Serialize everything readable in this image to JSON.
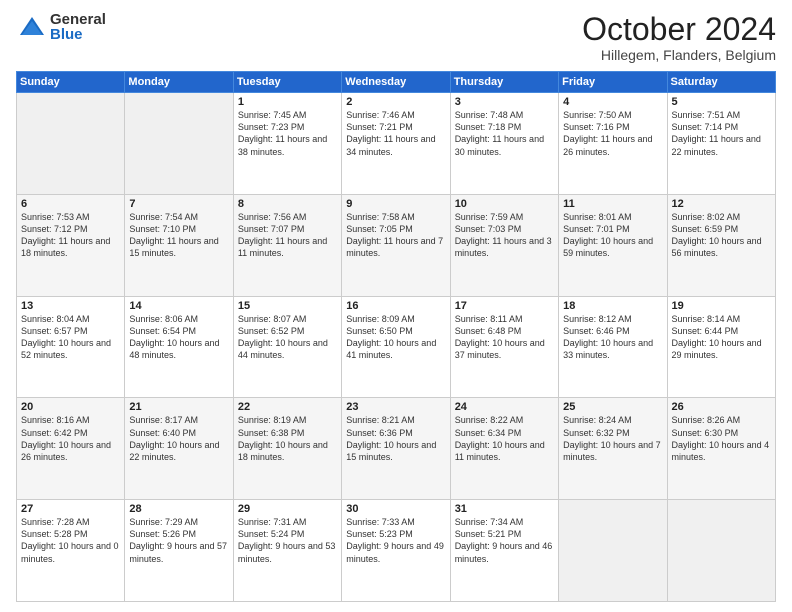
{
  "logo": {
    "general": "General",
    "blue": "Blue"
  },
  "title": "October 2024",
  "location": "Hillegem, Flanders, Belgium",
  "weekdays": [
    "Sunday",
    "Monday",
    "Tuesday",
    "Wednesday",
    "Thursday",
    "Friday",
    "Saturday"
  ],
  "weeks": [
    [
      {
        "day": "",
        "content": ""
      },
      {
        "day": "",
        "content": ""
      },
      {
        "day": "1",
        "content": "Sunrise: 7:45 AM\nSunset: 7:23 PM\nDaylight: 11 hours and 38 minutes."
      },
      {
        "day": "2",
        "content": "Sunrise: 7:46 AM\nSunset: 7:21 PM\nDaylight: 11 hours and 34 minutes."
      },
      {
        "day": "3",
        "content": "Sunrise: 7:48 AM\nSunset: 7:18 PM\nDaylight: 11 hours and 30 minutes."
      },
      {
        "day": "4",
        "content": "Sunrise: 7:50 AM\nSunset: 7:16 PM\nDaylight: 11 hours and 26 minutes."
      },
      {
        "day": "5",
        "content": "Sunrise: 7:51 AM\nSunset: 7:14 PM\nDaylight: 11 hours and 22 minutes."
      }
    ],
    [
      {
        "day": "6",
        "content": "Sunrise: 7:53 AM\nSunset: 7:12 PM\nDaylight: 11 hours and 18 minutes."
      },
      {
        "day": "7",
        "content": "Sunrise: 7:54 AM\nSunset: 7:10 PM\nDaylight: 11 hours and 15 minutes."
      },
      {
        "day": "8",
        "content": "Sunrise: 7:56 AM\nSunset: 7:07 PM\nDaylight: 11 hours and 11 minutes."
      },
      {
        "day": "9",
        "content": "Sunrise: 7:58 AM\nSunset: 7:05 PM\nDaylight: 11 hours and 7 minutes."
      },
      {
        "day": "10",
        "content": "Sunrise: 7:59 AM\nSunset: 7:03 PM\nDaylight: 11 hours and 3 minutes."
      },
      {
        "day": "11",
        "content": "Sunrise: 8:01 AM\nSunset: 7:01 PM\nDaylight: 10 hours and 59 minutes."
      },
      {
        "day": "12",
        "content": "Sunrise: 8:02 AM\nSunset: 6:59 PM\nDaylight: 10 hours and 56 minutes."
      }
    ],
    [
      {
        "day": "13",
        "content": "Sunrise: 8:04 AM\nSunset: 6:57 PM\nDaylight: 10 hours and 52 minutes."
      },
      {
        "day": "14",
        "content": "Sunrise: 8:06 AM\nSunset: 6:54 PM\nDaylight: 10 hours and 48 minutes."
      },
      {
        "day": "15",
        "content": "Sunrise: 8:07 AM\nSunset: 6:52 PM\nDaylight: 10 hours and 44 minutes."
      },
      {
        "day": "16",
        "content": "Sunrise: 8:09 AM\nSunset: 6:50 PM\nDaylight: 10 hours and 41 minutes."
      },
      {
        "day": "17",
        "content": "Sunrise: 8:11 AM\nSunset: 6:48 PM\nDaylight: 10 hours and 37 minutes."
      },
      {
        "day": "18",
        "content": "Sunrise: 8:12 AM\nSunset: 6:46 PM\nDaylight: 10 hours and 33 minutes."
      },
      {
        "day": "19",
        "content": "Sunrise: 8:14 AM\nSunset: 6:44 PM\nDaylight: 10 hours and 29 minutes."
      }
    ],
    [
      {
        "day": "20",
        "content": "Sunrise: 8:16 AM\nSunset: 6:42 PM\nDaylight: 10 hours and 26 minutes."
      },
      {
        "day": "21",
        "content": "Sunrise: 8:17 AM\nSunset: 6:40 PM\nDaylight: 10 hours and 22 minutes."
      },
      {
        "day": "22",
        "content": "Sunrise: 8:19 AM\nSunset: 6:38 PM\nDaylight: 10 hours and 18 minutes."
      },
      {
        "day": "23",
        "content": "Sunrise: 8:21 AM\nSunset: 6:36 PM\nDaylight: 10 hours and 15 minutes."
      },
      {
        "day": "24",
        "content": "Sunrise: 8:22 AM\nSunset: 6:34 PM\nDaylight: 10 hours and 11 minutes."
      },
      {
        "day": "25",
        "content": "Sunrise: 8:24 AM\nSunset: 6:32 PM\nDaylight: 10 hours and 7 minutes."
      },
      {
        "day": "26",
        "content": "Sunrise: 8:26 AM\nSunset: 6:30 PM\nDaylight: 10 hours and 4 minutes."
      }
    ],
    [
      {
        "day": "27",
        "content": "Sunrise: 7:28 AM\nSunset: 5:28 PM\nDaylight: 10 hours and 0 minutes."
      },
      {
        "day": "28",
        "content": "Sunrise: 7:29 AM\nSunset: 5:26 PM\nDaylight: 9 hours and 57 minutes."
      },
      {
        "day": "29",
        "content": "Sunrise: 7:31 AM\nSunset: 5:24 PM\nDaylight: 9 hours and 53 minutes."
      },
      {
        "day": "30",
        "content": "Sunrise: 7:33 AM\nSunset: 5:23 PM\nDaylight: 9 hours and 49 minutes."
      },
      {
        "day": "31",
        "content": "Sunrise: 7:34 AM\nSunset: 5:21 PM\nDaylight: 9 hours and 46 minutes."
      },
      {
        "day": "",
        "content": ""
      },
      {
        "day": "",
        "content": ""
      }
    ]
  ]
}
